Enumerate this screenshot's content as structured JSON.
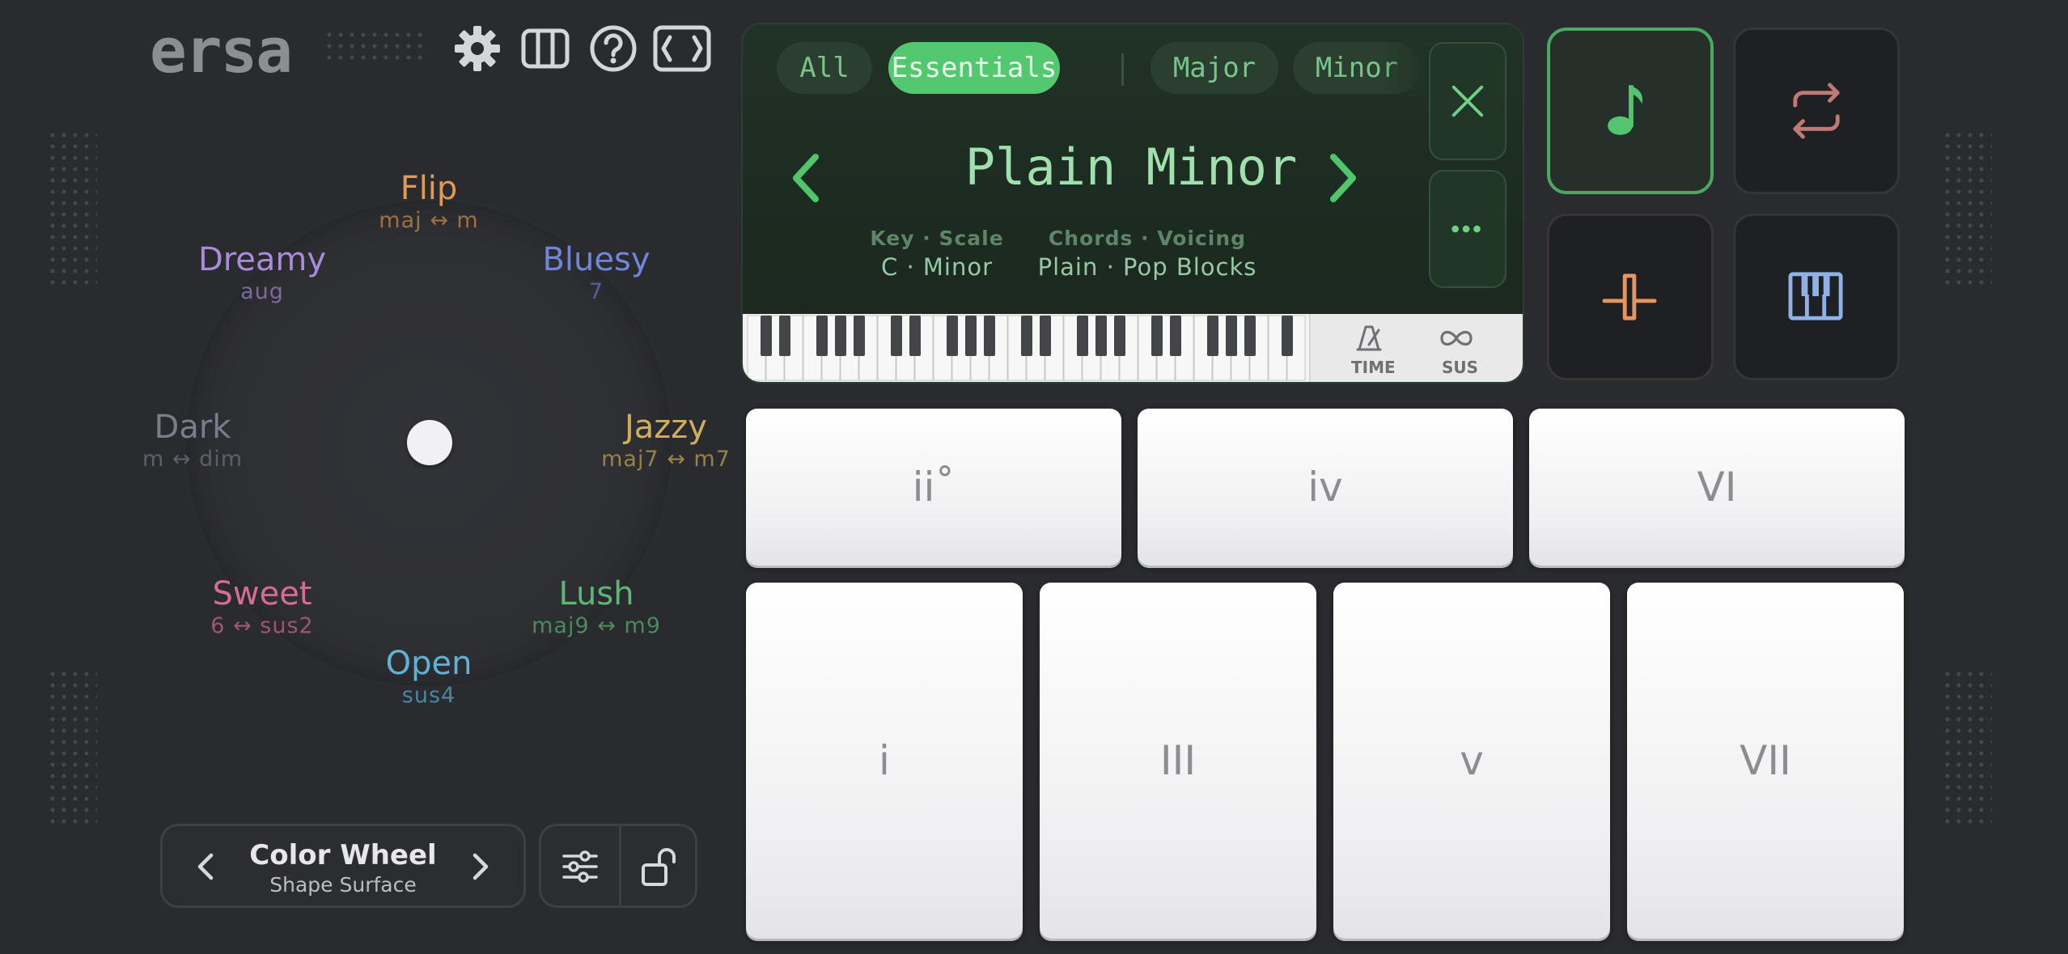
{
  "app": {
    "logo": "ersa"
  },
  "wheel": {
    "labels": [
      {
        "title": "Flip",
        "sub": "maj ↔ m",
        "color": "#e09a52"
      },
      {
        "title": "Bluesy",
        "sub": "7",
        "color": "#6f86d9"
      },
      {
        "title": "Jazzy",
        "sub": "maj7 ↔ m7",
        "color": "#d1ad5c"
      },
      {
        "title": "Lush",
        "sub": "maj9 ↔ m9",
        "color": "#5fb476"
      },
      {
        "title": "Open",
        "sub": "sus4",
        "color": "#5fb2d6"
      },
      {
        "title": "Sweet",
        "sub": "6 ↔ sus2",
        "color": "#d16d96"
      },
      {
        "title": "Dark",
        "sub": "m ↔ dim",
        "color": "#7a7e8c"
      },
      {
        "title": "Dreamy",
        "sub": "aug",
        "color": "#a98bd9"
      }
    ]
  },
  "shape": {
    "title": "Color Wheel",
    "subtitle": "Shape Surface"
  },
  "display": {
    "filters": [
      "All",
      "Essentials",
      "Major",
      "Minor"
    ],
    "active_filter": "Essentials",
    "preset_name": "Plain Minor",
    "key_label": "Key · Scale",
    "key_value": "C · Minor",
    "chords_label": "Chords · Voicing",
    "chords_value": "Plain · Pop Blocks",
    "time_label": "TIME",
    "sus_label": "SUS"
  },
  "pads": {
    "top": [
      "ii˚",
      "iv",
      "VI"
    ],
    "bottom": [
      "i",
      "III",
      "v",
      "VII"
    ]
  },
  "colors": {
    "accent": "#53c86f",
    "background": "#2a2b2e"
  }
}
